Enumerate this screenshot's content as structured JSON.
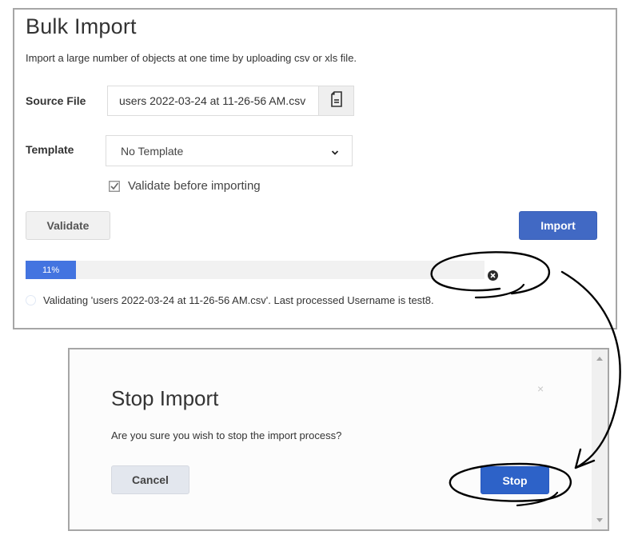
{
  "bulk_import": {
    "title": "Bulk Import",
    "subtitle": "Import a large number of objects at one time by uploading csv or xls file.",
    "source_file": {
      "label": "Source File",
      "value": "users 2022-03-24 at 11-26-56 AM.csv",
      "browse_icon": "file-icon"
    },
    "template": {
      "label": "Template",
      "selected": "No Template",
      "icon": "chevron-down-icon"
    },
    "validate_checkbox": {
      "label": "Validate before importing",
      "checked": true
    },
    "buttons": {
      "validate": "Validate",
      "import": "Import"
    },
    "progress": {
      "percent": 11,
      "label": "11%",
      "cancel_icon": "close-circle-icon"
    },
    "status": "Validating 'users 2022-03-24 at 11-26-56 AM.csv'. Last processed Username is test8."
  },
  "stop_dialog": {
    "title": "Stop Import",
    "close_icon": "close-icon",
    "close_glyph": "×",
    "message": "Are you sure you wish to stop the import process?",
    "buttons": {
      "cancel": "Cancel",
      "stop": "Stop"
    }
  },
  "colors": {
    "primary": "#4169c4",
    "stop_button": "#2d62c8",
    "progress_fill": "#4374e0",
    "progress_track": "#f1f1f1",
    "border": "#a6a6a6"
  }
}
